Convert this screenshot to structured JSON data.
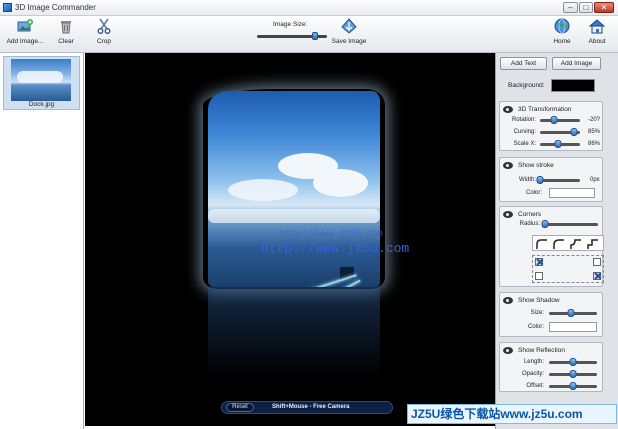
{
  "window": {
    "title": "3D Image Commander",
    "controls": {
      "minimize": "–",
      "maximize": "□",
      "close": "✕"
    }
  },
  "toolbar": {
    "add_image": "Add Image...",
    "clear": "Clear",
    "crop": "Crop",
    "image_size_label": "Image Size:",
    "image_size_level": 0.83,
    "save_image": "Save Image",
    "home": "Home",
    "about": "About"
  },
  "thumbnails": [
    {
      "caption": "Dock.jpg"
    }
  ],
  "canvas": {
    "watermark_small": "http://www.jz5u.com",
    "watermark_large": "http://www.jz5u.com",
    "reset_label": "Reset",
    "hint": "Shift+Mouse - Free Camera"
  },
  "settings": {
    "add_text": "Add Text",
    "add_image": "Add Image",
    "background_label": "Background:",
    "background_color": "#000000",
    "transformation": {
      "title": "3D Transformation",
      "rows": [
        {
          "label": "Rotation:",
          "value": "-20?",
          "level": 0.35
        },
        {
          "label": "Curving:",
          "value": "85%",
          "level": 0.85
        },
        {
          "label": "Scale X:",
          "value": "86%",
          "level": 0.45
        }
      ]
    },
    "stroke": {
      "title": "Show stroke",
      "width_label": "Width:",
      "width_value": "0px",
      "width_level": 0.0,
      "color_label": "Color:"
    },
    "corners": {
      "title": "Corners",
      "radius_label": "Radius:",
      "radius_level": 0.02,
      "checks": [
        true,
        false,
        false,
        true
      ]
    },
    "shadow": {
      "title": "Show Shadow",
      "size_label": "Size:",
      "size_level": 0.45,
      "color_label": "Color:"
    },
    "reflection": {
      "title": "Show Reflection",
      "rows": [
        {
          "label": "Length:",
          "level": 0.5
        },
        {
          "label": "Opacity:",
          "level": 0.5
        },
        {
          "label": "Offset:",
          "level": 0.5
        }
      ]
    }
  },
  "overlay": {
    "banner": "JZ5U绿色下载站www.jz5u.com"
  },
  "colors": {
    "slider_thumb": "#2d6db6",
    "close_button": "#c23a22",
    "canvas_bg": "#000000"
  }
}
